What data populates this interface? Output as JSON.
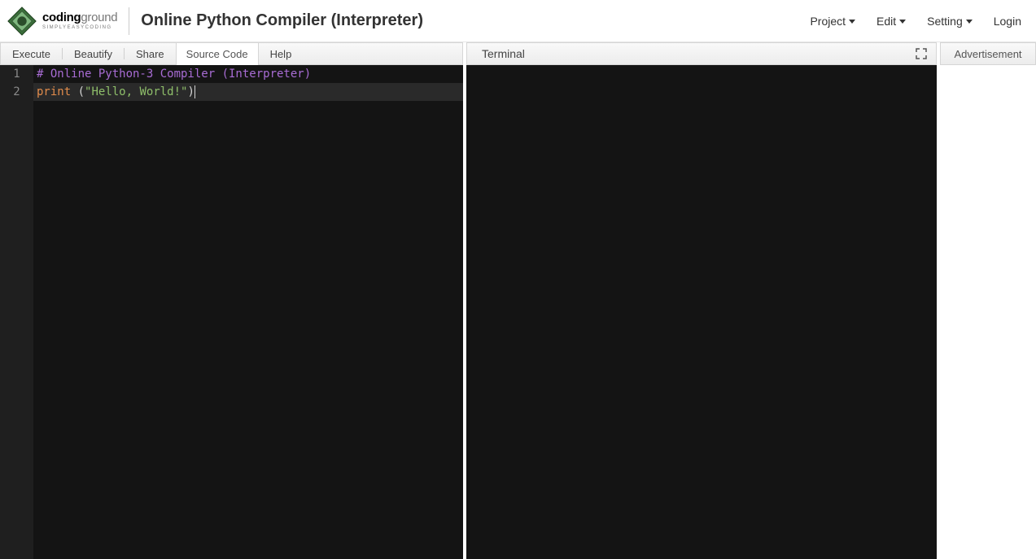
{
  "header": {
    "logo": {
      "line1a": "coding",
      "line1b": "ground",
      "line2": "SIMPLYEASYCODING"
    },
    "title": "Online Python Compiler (Interpreter)",
    "menu": {
      "project": "Project",
      "edit": "Edit",
      "setting": "Setting",
      "login": "Login"
    }
  },
  "editor_toolbar": {
    "execute": "Execute",
    "beautify": "Beautify",
    "share": "Share",
    "source_code_tab": "Source Code",
    "help": "Help"
  },
  "terminal": {
    "title": "Terminal"
  },
  "ad": {
    "title": "Advertisement"
  },
  "code": {
    "line_numbers": [
      "1",
      "2"
    ],
    "line1_comment": "# Online Python-3 Compiler (Interpreter)",
    "line2_keyword": "print",
    "line2_space": " ",
    "line2_open": "(",
    "line2_string": "\"Hello, World!\"",
    "line2_close": ")"
  }
}
